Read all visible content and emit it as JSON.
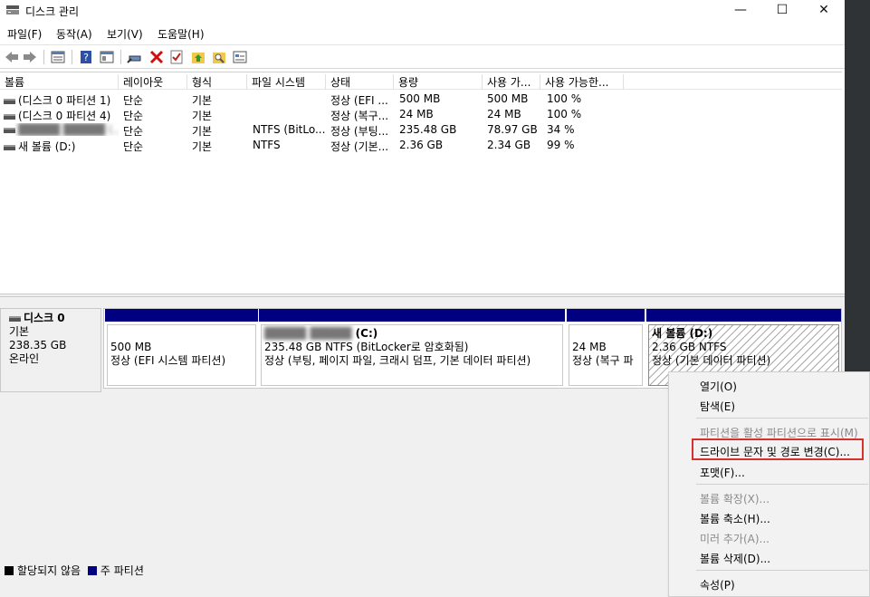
{
  "window": {
    "title": "디스크 관리",
    "minimize": "—",
    "maximize": "☐",
    "close": "✕"
  },
  "menu": [
    "파일(F)",
    "동작(A)",
    "보기(V)",
    "도움말(H)"
  ],
  "toolbar": {
    "icons": [
      "back-arrow-icon",
      "forward-arrow-icon",
      "list-view-icon",
      "help-icon",
      "properties-icon",
      "connect-icon",
      "delete-icon",
      "check-icon",
      "up-folder-icon",
      "search-folder-icon",
      "graphical-view-icon"
    ]
  },
  "list": {
    "headers": [
      "볼륨",
      "레이아웃",
      "형식",
      "파일 시스템",
      "상태",
      "용량",
      "사용 가...",
      "사용 가능한..."
    ],
    "rows": [
      [
        "(디스크 0 파티션 1)",
        "단순",
        "기본",
        "",
        "정상 (EFI ...",
        "500 MB",
        "500 MB",
        "100 %"
      ],
      [
        "(디스크 0 파티션 4)",
        "단순",
        "기본",
        "",
        "정상 (복구...",
        "24 MB",
        "24 MB",
        "100 %"
      ],
      [
        "█████ █████ (...",
        "단순",
        "기본",
        "NTFS (BitLo...",
        "정상 (부팅...",
        "235.48 GB",
        "78.97 GB",
        "34 %"
      ],
      [
        "새 볼륨 (D:)",
        "단순",
        "기본",
        "NTFS",
        "정상 (기본...",
        "2.36 GB",
        "2.34 GB",
        "99 %"
      ]
    ]
  },
  "disk": {
    "name": "디스크 0",
    "type": "기본",
    "size": "238.35 GB",
    "status": "온라인",
    "partitions": [
      {
        "title": "",
        "line1": "500 MB",
        "line2": "정상 (EFI 시스템 파티션)"
      },
      {
        "title": "(C:)",
        "blurred_name": "█████ █████",
        "line1": "235.48 GB NTFS (BitLocker로 암호화됨)",
        "line2": "정상 (부팅, 페이지 파일, 크래시 덤프, 기본 데이터 파티션)"
      },
      {
        "title": "",
        "line1": "24 MB",
        "line2": "정상 (복구 파"
      },
      {
        "title": "새 볼륨  (D:)",
        "line1": "2.36 GB NTFS",
        "line2": "정상 (기본 데이터 파티션)"
      }
    ]
  },
  "legend": {
    "unallocated": "할당되지 않음",
    "primary": "주 파티션",
    "unallocated_color": "#000000",
    "primary_color": "#000080"
  },
  "context_menu": {
    "open": "열기(O)",
    "explore": "탐색(E)",
    "mark_active": "파티션을 활성 파티션으로 표시(M)",
    "change_letter": "드라이브 문자 및 경로 변경(C)...",
    "format": "포맷(F)...",
    "extend": "볼륨 확장(X)...",
    "shrink": "볼륨 축소(H)...",
    "add_mirror": "미러 추가(A)...",
    "delete": "볼륨 삭제(D)...",
    "properties": "속성(P)"
  }
}
